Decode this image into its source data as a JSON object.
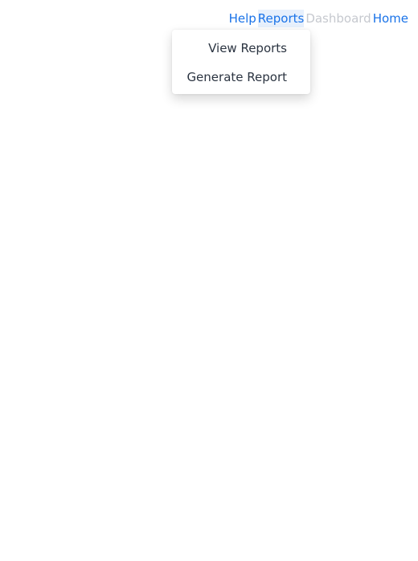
{
  "nav": {
    "items": [
      {
        "label": "Help",
        "state": "normal"
      },
      {
        "label": "Reports",
        "state": "active"
      },
      {
        "label": "Dashboard",
        "state": "disabled"
      },
      {
        "label": "Home",
        "state": "normal"
      }
    ]
  },
  "reports_menu": {
    "items": [
      {
        "label": "View Reports"
      },
      {
        "label": "Generate Report"
      }
    ]
  },
  "colors": {
    "link": "#1a73e8",
    "disabled": "#c6c9cf",
    "active_bg": "#e7f0fc",
    "menu_text": "#2b3441"
  }
}
